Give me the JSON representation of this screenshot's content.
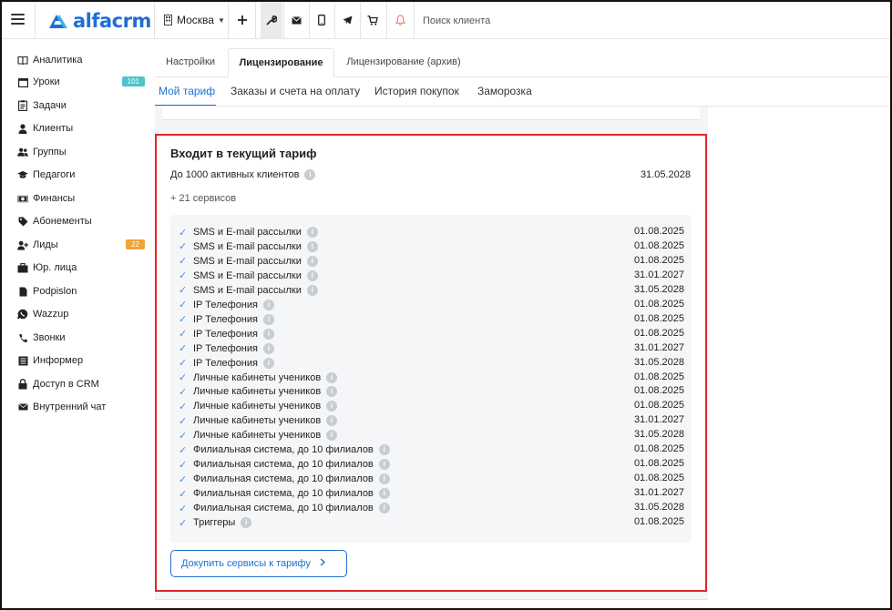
{
  "header": {
    "logo_text": "alfacrm",
    "city": "Москва",
    "search_placeholder": "Поиск клиента",
    "icons": [
      "hamburger-icon",
      "building-icon",
      "plus-icon",
      "wrench-icon",
      "mail-icon",
      "phone-icon",
      "telegram-icon",
      "cart-icon",
      "bell-icon"
    ],
    "brand_color": "#1f6fd1"
  },
  "sidebar": {
    "items": [
      {
        "label": "Аналитика",
        "icon": "book-icon"
      },
      {
        "label": "Уроки",
        "icon": "calendar-icon",
        "badge": "101",
        "badge_color": "#4fc3c7"
      },
      {
        "label": "Задачи",
        "icon": "clipboard-icon"
      },
      {
        "label": "Клиенты",
        "icon": "user-icon"
      },
      {
        "label": "Группы",
        "icon": "users-icon"
      },
      {
        "label": "Педагоги",
        "icon": "graduation-cap-icon"
      },
      {
        "label": "Финансы",
        "icon": "money-icon"
      },
      {
        "label": "Абонементы",
        "icon": "tag-icon"
      },
      {
        "label": "Лиды",
        "icon": "user-plus-icon",
        "badge": "22",
        "badge_color": "#f0a434"
      },
      {
        "label": "Юр. лица",
        "icon": "briefcase-icon"
      },
      {
        "label": "Podpislon",
        "icon": "file-icon"
      },
      {
        "label": "Wazzup",
        "icon": "whatsapp-icon"
      },
      {
        "label": "Звонки",
        "icon": "phone-handset-icon"
      },
      {
        "label": "Информер",
        "icon": "list-icon"
      },
      {
        "label": "Доступ в CRM",
        "icon": "lock-icon"
      },
      {
        "label": "Внутренний чат",
        "icon": "envelope-icon"
      }
    ]
  },
  "tabs": {
    "primary": [
      {
        "label": "Настройки",
        "active": false
      },
      {
        "label": "Лицензирование",
        "active": true
      },
      {
        "label": "Лицензирование (архив)",
        "active": false
      }
    ],
    "secondary": [
      {
        "label": "Мой тариф",
        "active": true
      },
      {
        "label": "Заказы и счета на оплату",
        "active": false
      },
      {
        "label": "История покупок",
        "active": false
      },
      {
        "label": "Заморозка",
        "active": false
      }
    ]
  },
  "card": {
    "title": "Входит в текущий тариф",
    "plan_line": "До 1000 активных клиентов",
    "plan_date": "31.05.2028",
    "extra_services": "+ 21 сервисов",
    "services": [
      {
        "name": "SMS и E-mail рассылки",
        "date": "01.08.2025"
      },
      {
        "name": "SMS и E-mail рассылки",
        "date": "01.08.2025"
      },
      {
        "name": "SMS и E-mail рассылки",
        "date": "01.08.2025"
      },
      {
        "name": "SMS и E-mail рассылки",
        "date": "31.01.2027"
      },
      {
        "name": "SMS и E-mail рассылки",
        "date": "31.05.2028"
      },
      {
        "name": "IP Телефония",
        "date": "01.08.2025"
      },
      {
        "name": "IP Телефония",
        "date": "01.08.2025"
      },
      {
        "name": "IP Телефония",
        "date": "01.08.2025"
      },
      {
        "name": "IP Телефония",
        "date": "31.01.2027"
      },
      {
        "name": "IP Телефония",
        "date": "31.05.2028"
      },
      {
        "name": "Личные кабинеты учеников",
        "date": "01.08.2025"
      },
      {
        "name": "Личные кабинеты учеников",
        "date": "01.08.2025"
      },
      {
        "name": "Личные кабинеты учеников",
        "date": "01.08.2025"
      },
      {
        "name": "Личные кабинеты учеников",
        "date": "31.01.2027"
      },
      {
        "name": "Личные кабинеты учеников",
        "date": "31.05.2028"
      },
      {
        "name": "Филиальная система, до 10 филиалов",
        "date": "01.08.2025"
      },
      {
        "name": "Филиальная система, до 10 филиалов",
        "date": "01.08.2025"
      },
      {
        "name": "Филиальная система, до 10 филиалов",
        "date": "01.08.2025"
      },
      {
        "name": "Филиальная система, до 10 филиалов",
        "date": "31.01.2027"
      },
      {
        "name": "Филиальная система, до 10 филиалов",
        "date": "31.05.2028"
      },
      {
        "name": "Триггеры",
        "date": "01.08.2025"
      }
    ],
    "buy_button": "Докупить сервисы к тарифу",
    "highlight_color": "#e0262b"
  }
}
